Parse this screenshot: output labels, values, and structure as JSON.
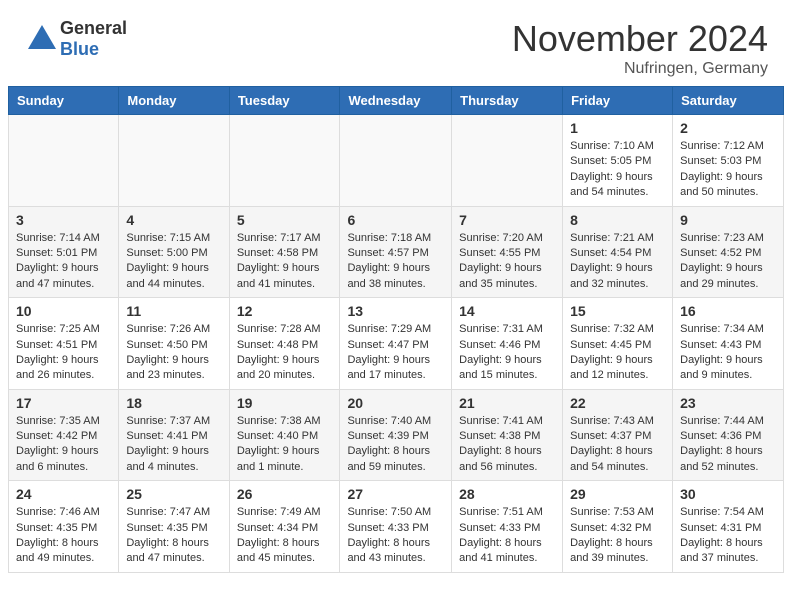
{
  "header": {
    "logo_general": "General",
    "logo_blue": "Blue",
    "month_title": "November 2024",
    "location": "Nufringen, Germany"
  },
  "calendar": {
    "days_of_week": [
      "Sunday",
      "Monday",
      "Tuesday",
      "Wednesday",
      "Thursday",
      "Friday",
      "Saturday"
    ],
    "weeks": [
      [
        {
          "day": "",
          "empty": true
        },
        {
          "day": "",
          "empty": true
        },
        {
          "day": "",
          "empty": true
        },
        {
          "day": "",
          "empty": true
        },
        {
          "day": "",
          "empty": true
        },
        {
          "day": "1",
          "info": "Sunrise: 7:10 AM\nSunset: 5:05 PM\nDaylight: 9 hours and 54 minutes."
        },
        {
          "day": "2",
          "info": "Sunrise: 7:12 AM\nSunset: 5:03 PM\nDaylight: 9 hours and 50 minutes."
        }
      ],
      [
        {
          "day": "3",
          "info": "Sunrise: 7:14 AM\nSunset: 5:01 PM\nDaylight: 9 hours and 47 minutes."
        },
        {
          "day": "4",
          "info": "Sunrise: 7:15 AM\nSunset: 5:00 PM\nDaylight: 9 hours and 44 minutes."
        },
        {
          "day": "5",
          "info": "Sunrise: 7:17 AM\nSunset: 4:58 PM\nDaylight: 9 hours and 41 minutes."
        },
        {
          "day": "6",
          "info": "Sunrise: 7:18 AM\nSunset: 4:57 PM\nDaylight: 9 hours and 38 minutes."
        },
        {
          "day": "7",
          "info": "Sunrise: 7:20 AM\nSunset: 4:55 PM\nDaylight: 9 hours and 35 minutes."
        },
        {
          "day": "8",
          "info": "Sunrise: 7:21 AM\nSunset: 4:54 PM\nDaylight: 9 hours and 32 minutes."
        },
        {
          "day": "9",
          "info": "Sunrise: 7:23 AM\nSunset: 4:52 PM\nDaylight: 9 hours and 29 minutes."
        }
      ],
      [
        {
          "day": "10",
          "info": "Sunrise: 7:25 AM\nSunset: 4:51 PM\nDaylight: 9 hours and 26 minutes."
        },
        {
          "day": "11",
          "info": "Sunrise: 7:26 AM\nSunset: 4:50 PM\nDaylight: 9 hours and 23 minutes."
        },
        {
          "day": "12",
          "info": "Sunrise: 7:28 AM\nSunset: 4:48 PM\nDaylight: 9 hours and 20 minutes."
        },
        {
          "day": "13",
          "info": "Sunrise: 7:29 AM\nSunset: 4:47 PM\nDaylight: 9 hours and 17 minutes."
        },
        {
          "day": "14",
          "info": "Sunrise: 7:31 AM\nSunset: 4:46 PM\nDaylight: 9 hours and 15 minutes."
        },
        {
          "day": "15",
          "info": "Sunrise: 7:32 AM\nSunset: 4:45 PM\nDaylight: 9 hours and 12 minutes."
        },
        {
          "day": "16",
          "info": "Sunrise: 7:34 AM\nSunset: 4:43 PM\nDaylight: 9 hours and 9 minutes."
        }
      ],
      [
        {
          "day": "17",
          "info": "Sunrise: 7:35 AM\nSunset: 4:42 PM\nDaylight: 9 hours and 6 minutes."
        },
        {
          "day": "18",
          "info": "Sunrise: 7:37 AM\nSunset: 4:41 PM\nDaylight: 9 hours and 4 minutes."
        },
        {
          "day": "19",
          "info": "Sunrise: 7:38 AM\nSunset: 4:40 PM\nDaylight: 9 hours and 1 minute."
        },
        {
          "day": "20",
          "info": "Sunrise: 7:40 AM\nSunset: 4:39 PM\nDaylight: 8 hours and 59 minutes."
        },
        {
          "day": "21",
          "info": "Sunrise: 7:41 AM\nSunset: 4:38 PM\nDaylight: 8 hours and 56 minutes."
        },
        {
          "day": "22",
          "info": "Sunrise: 7:43 AM\nSunset: 4:37 PM\nDaylight: 8 hours and 54 minutes."
        },
        {
          "day": "23",
          "info": "Sunrise: 7:44 AM\nSunset: 4:36 PM\nDaylight: 8 hours and 52 minutes."
        }
      ],
      [
        {
          "day": "24",
          "info": "Sunrise: 7:46 AM\nSunset: 4:35 PM\nDaylight: 8 hours and 49 minutes."
        },
        {
          "day": "25",
          "info": "Sunrise: 7:47 AM\nSunset: 4:35 PM\nDaylight: 8 hours and 47 minutes."
        },
        {
          "day": "26",
          "info": "Sunrise: 7:49 AM\nSunset: 4:34 PM\nDaylight: 8 hours and 45 minutes."
        },
        {
          "day": "27",
          "info": "Sunrise: 7:50 AM\nSunset: 4:33 PM\nDaylight: 8 hours and 43 minutes."
        },
        {
          "day": "28",
          "info": "Sunrise: 7:51 AM\nSunset: 4:33 PM\nDaylight: 8 hours and 41 minutes."
        },
        {
          "day": "29",
          "info": "Sunrise: 7:53 AM\nSunset: 4:32 PM\nDaylight: 8 hours and 39 minutes."
        },
        {
          "day": "30",
          "info": "Sunrise: 7:54 AM\nSunset: 4:31 PM\nDaylight: 8 hours and 37 minutes."
        }
      ]
    ]
  }
}
